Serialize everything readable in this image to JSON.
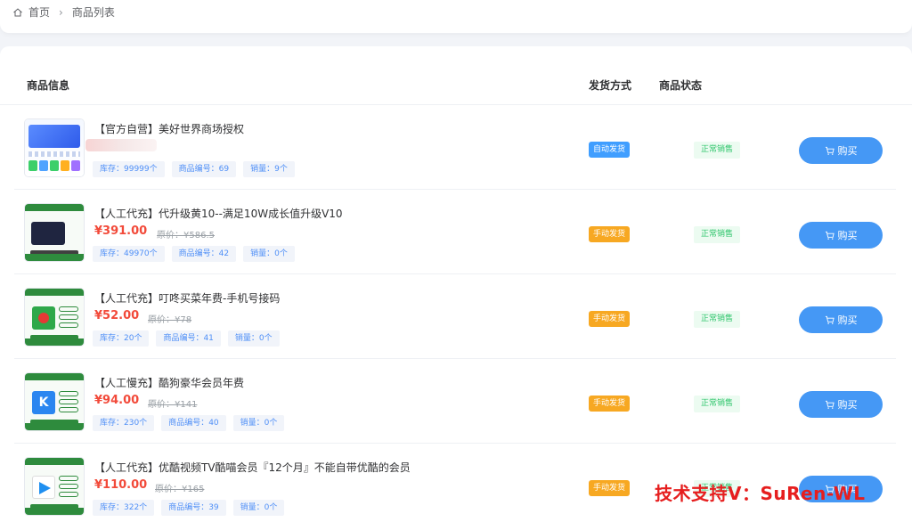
{
  "breadcrumb": {
    "home": "首页",
    "current": "商品列表"
  },
  "table": {
    "headers": {
      "info": "商品信息",
      "delivery": "发货方式",
      "status": "商品状态"
    },
    "buy_label": "购买",
    "rows": [
      {
        "name": "【官方自营】美好世界商场授权",
        "price": "",
        "original_price": "",
        "stock": "库存：99999个",
        "code": "商品编号：69",
        "sales": "销量：9个",
        "delivery": "自动发货",
        "status": "正常销售"
      },
      {
        "name": "【人工代充】代升级黄10--满足10W成长值升级V10",
        "price": "¥391.00",
        "original_price": "原价：¥586.5",
        "stock": "库存：49970个",
        "code": "商品编号：42",
        "sales": "销量：0个",
        "delivery": "手动发货",
        "status": "正常销售"
      },
      {
        "name": "【人工代充】叮咚买菜年费-手机号接码",
        "price": "¥52.00",
        "original_price": "原价：¥78",
        "stock": "库存：20个",
        "code": "商品编号：41",
        "sales": "销量：0个",
        "delivery": "手动发货",
        "status": "正常销售"
      },
      {
        "name": "【人工慢充】酷狗豪华会员年费",
        "price": "¥94.00",
        "original_price": "原价：¥141",
        "stock": "库存：230个",
        "code": "商品编号：40",
        "sales": "销量：0个",
        "delivery": "手动发货",
        "status": "正常销售"
      },
      {
        "name": "【人工代充】优酷视频TV酷喵会员『12个月』不能自带优酷的会员",
        "price": "¥110.00",
        "original_price": "原价：¥165",
        "stock": "库存：322个",
        "code": "商品编号：39",
        "sales": "销量：0个",
        "delivery": "手动发货",
        "status": "正常销售"
      }
    ]
  },
  "watermark": "技术支持V：SuRen-WL",
  "colors": {
    "accent": "#4598f5",
    "price": "#f24a3a",
    "auto_delivery": "#409eff",
    "manual_delivery": "#f7a822",
    "status_text": "#2ec56b"
  }
}
